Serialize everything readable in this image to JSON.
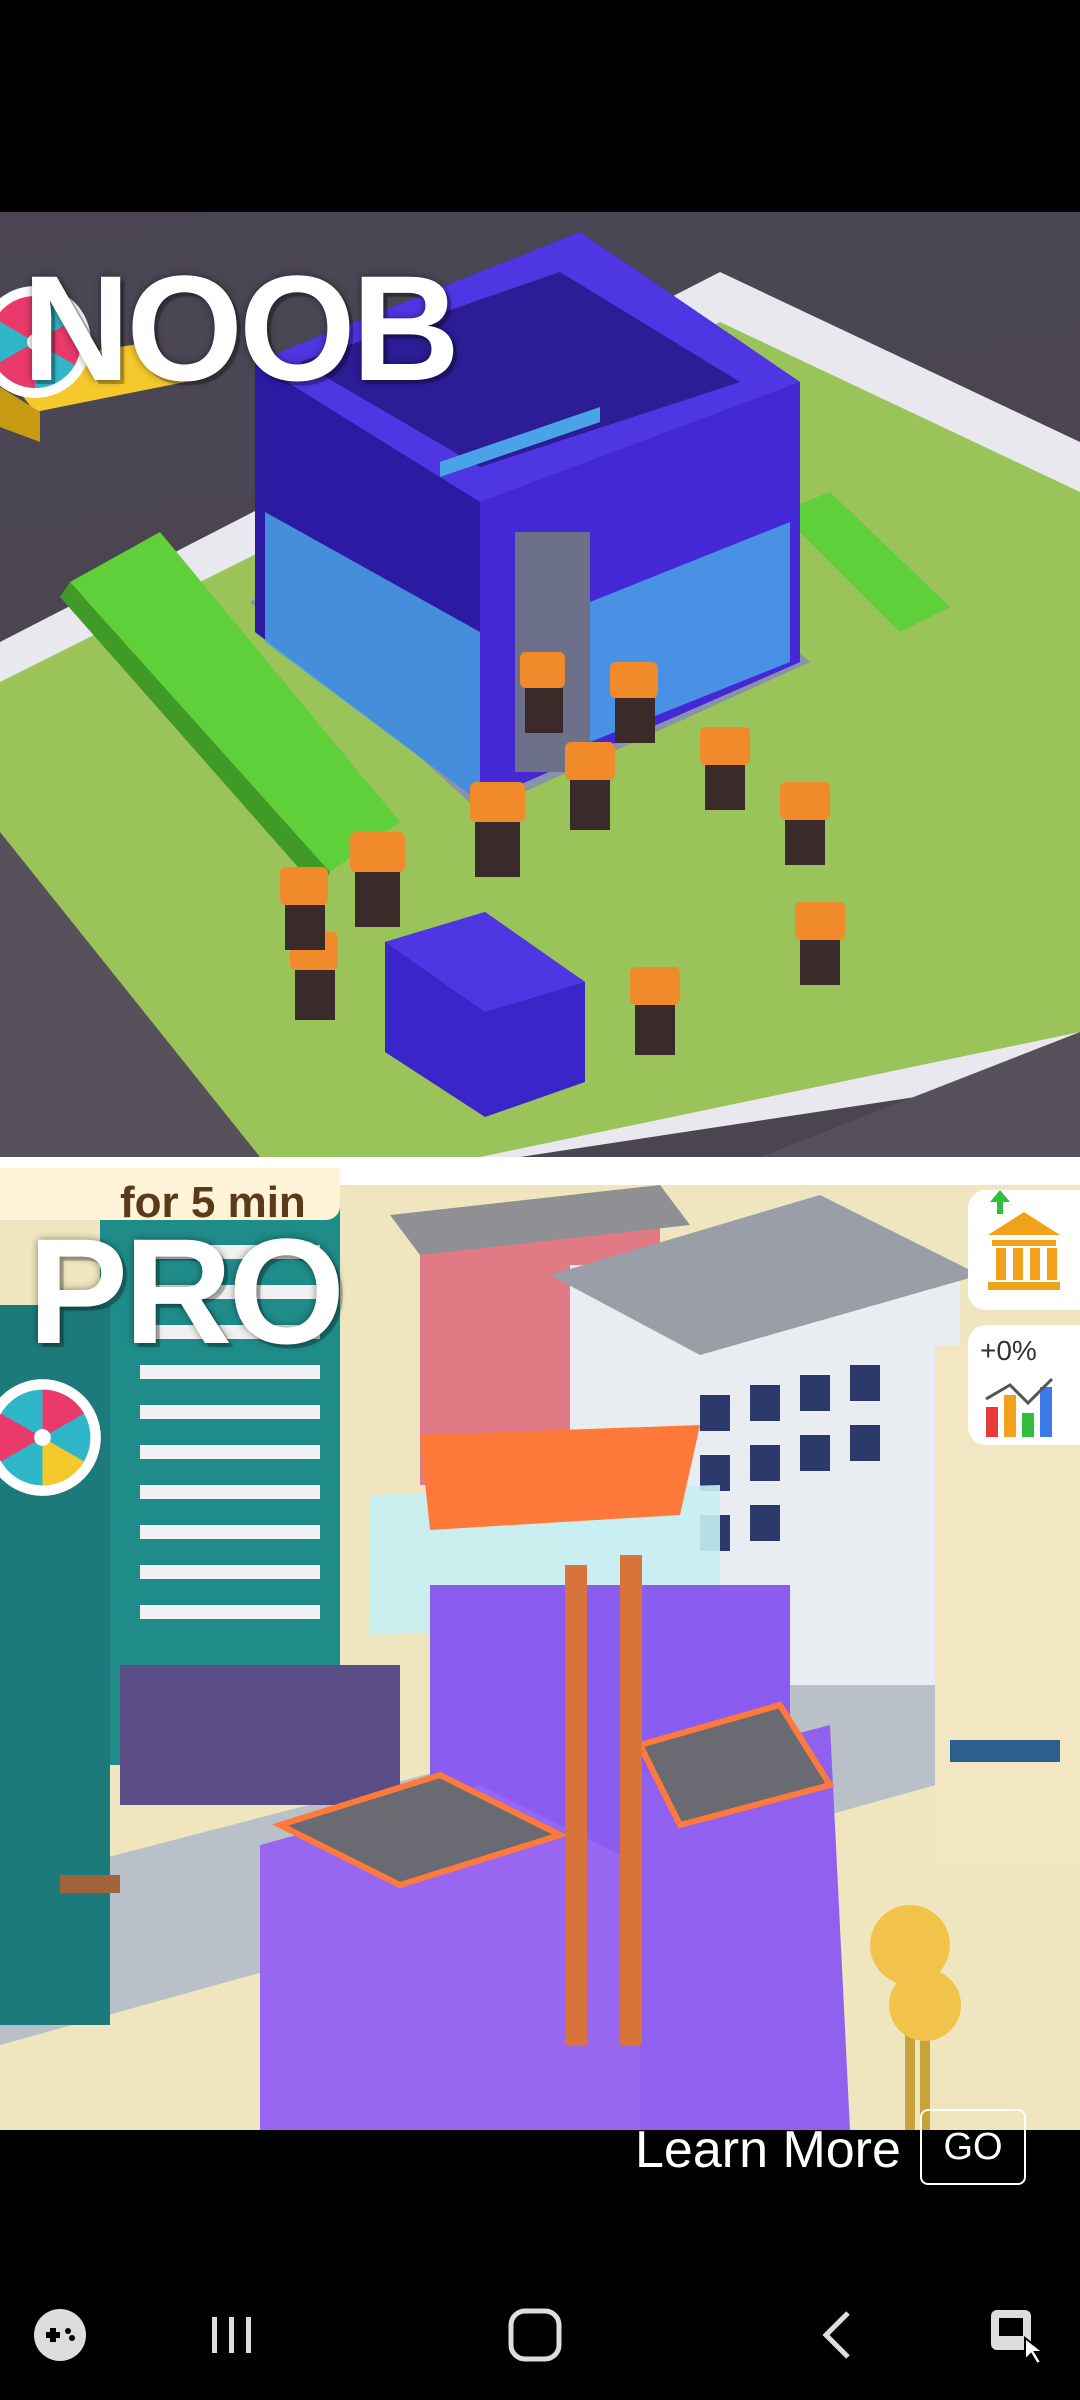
{
  "noob": {
    "label": "NOOB"
  },
  "pro": {
    "label": "PRO",
    "timer_text": "for 5 min",
    "percent_text": "+0%"
  },
  "ad": {
    "learn_more": "Learn More",
    "go": "GO"
  },
  "icons": [
    "spin-wheel-icon",
    "bank-icon",
    "stats-chart-icon",
    "gamepad-icon",
    "recent-apps-icon",
    "home-icon",
    "back-icon",
    "accessibility-icon"
  ]
}
